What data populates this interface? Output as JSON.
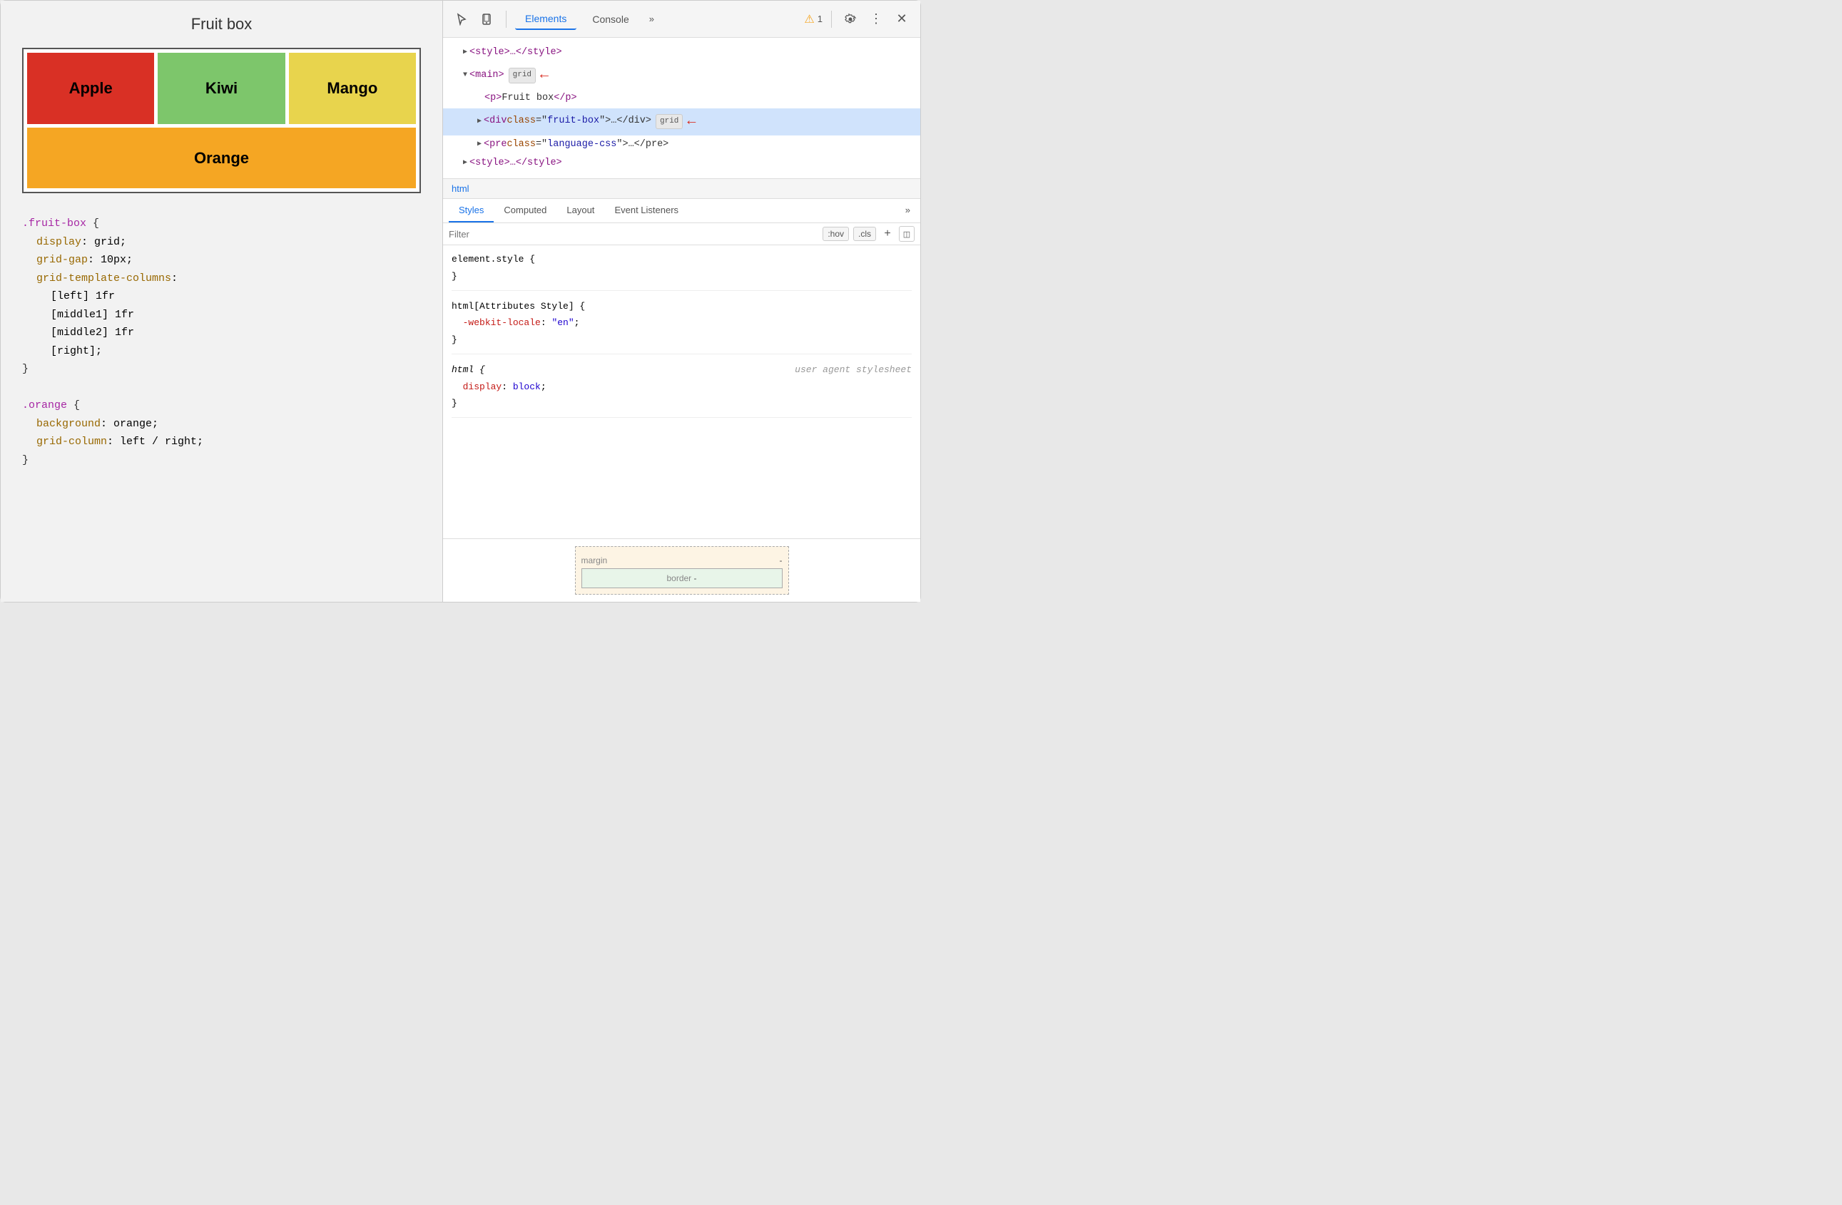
{
  "left": {
    "title": "Fruit box",
    "fruits": [
      {
        "name": "Apple",
        "class": "fruit-apple"
      },
      {
        "name": "Kiwi",
        "class": "fruit-kiwi"
      },
      {
        "name": "Mango",
        "class": "fruit-mango"
      },
      {
        "name": "Orange",
        "class": "fruit-orange"
      }
    ],
    "code": {
      "block1_selector": ".fruit-box {",
      "block1_lines": [
        "  display: grid;",
        "  grid-gap: 10px;",
        "  grid-template-columns:",
        "    [left] 1fr",
        "    [middle1] 1fr",
        "    [middle2] 1fr",
        "    [right];"
      ],
      "block1_close": "}",
      "block2_selector": ".orange {",
      "block2_lines": [
        "  background: orange;",
        "  grid-column: left / right;"
      ],
      "block2_close": "}"
    }
  },
  "right": {
    "toolbar": {
      "tabs": [
        "Elements",
        "Console"
      ],
      "more_label": "»",
      "warning_count": "1",
      "active_tab": "Elements"
    },
    "dom_tree": {
      "lines": [
        {
          "indent": 0,
          "content": "▶ <style>…</style>",
          "badge": null,
          "selected": false
        },
        {
          "indent": 0,
          "content": "▼ <main>",
          "badge": "grid",
          "selected": false,
          "has_arrow": true
        },
        {
          "indent": 1,
          "content": "<p>Fruit box</p>",
          "badge": null,
          "selected": false
        },
        {
          "indent": 1,
          "content": "▶ <div class=\"fruit-box\">…</div>",
          "badge": "grid",
          "selected": true,
          "has_arrow": true
        },
        {
          "indent": 1,
          "content": "▶ <pre class=\"language-css\">…</pre>",
          "badge": null,
          "selected": false
        },
        {
          "indent": 0,
          "content": "▶ <style>…</style>",
          "badge": null,
          "selected": false
        }
      ]
    },
    "context_bar": "html",
    "styles_tabs": [
      "Styles",
      "Computed",
      "Layout",
      "Event Listeners"
    ],
    "active_styles_tab": "Styles",
    "filter_placeholder": "Filter",
    "filter_buttons": [
      ":hov",
      ".cls"
    ],
    "styles_rules": [
      {
        "selector": "element.style {",
        "close": "}",
        "props": []
      },
      {
        "selector": "html[Attributes Style] {",
        "close": "}",
        "props": [
          {
            "name": "-webkit-locale",
            "value": "\"en\"",
            "color": "red"
          }
        ]
      },
      {
        "selector": "html {",
        "comment": "user agent stylesheet",
        "close": "}",
        "props": [
          {
            "name": "display",
            "value": "block",
            "color": "red"
          }
        ],
        "italic": true
      }
    ],
    "box_model": {
      "margin_label": "margin",
      "margin_value": "-",
      "border_label": "border",
      "border_value": "-"
    }
  }
}
